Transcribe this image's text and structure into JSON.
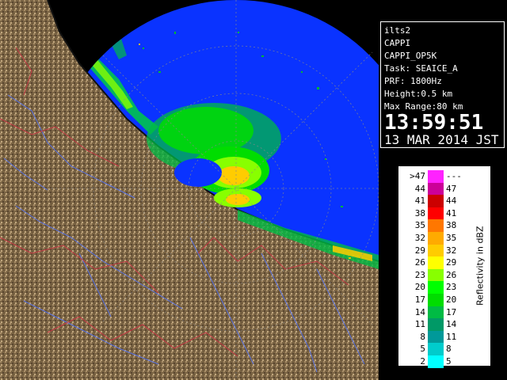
{
  "info": {
    "site": "ilts2",
    "product": "CAPPI",
    "product_name": "CAPPI_OP5K",
    "task": "Task: SEAICE_A",
    "prf": "PRF: 1800Hz",
    "height": "Height:0.5 km",
    "max_range": "Max Range:80 km",
    "time": "13:59:51",
    "date": "13 MAR 2014 JST"
  },
  "legend": {
    "title": "Reflectivity in dBZ",
    "rows": [
      {
        "low": ">47",
        "high": "---",
        "color": "#ff22ff"
      },
      {
        "low": "44",
        "high": "47",
        "color": "#cc0099"
      },
      {
        "low": "41",
        "high": "44",
        "color": "#cc0000"
      },
      {
        "low": "38",
        "high": "41",
        "color": "#ff0000"
      },
      {
        "low": "35",
        "high": "38",
        "color": "#ff7700"
      },
      {
        "low": "32",
        "high": "35",
        "color": "#ffaa00"
      },
      {
        "low": "29",
        "high": "32",
        "color": "#ffcc00"
      },
      {
        "low": "26",
        "high": "29",
        "color": "#ffff00"
      },
      {
        "low": "23",
        "high": "26",
        "color": "#88ff00"
      },
      {
        "low": "20",
        "high": "23",
        "color": "#00ff00"
      },
      {
        "low": "17",
        "high": "20",
        "color": "#00dd00"
      },
      {
        "low": "14",
        "high": "17",
        "color": "#00bb44"
      },
      {
        "low": "11",
        "high": "14",
        "color": "#009966"
      },
      {
        "low": "8",
        "high": "11",
        "color": "#009999"
      },
      {
        "low": "5",
        "high": "8",
        "color": "#00cccc"
      },
      {
        "low": "2",
        "high": "5",
        "color": "#00ffff"
      }
    ]
  },
  "colors": {
    "sea": "#0a33ff",
    "land": "#7a6444",
    "river": "#5577ff",
    "boundary": "#cc3344",
    "range_ring": "#888888"
  }
}
